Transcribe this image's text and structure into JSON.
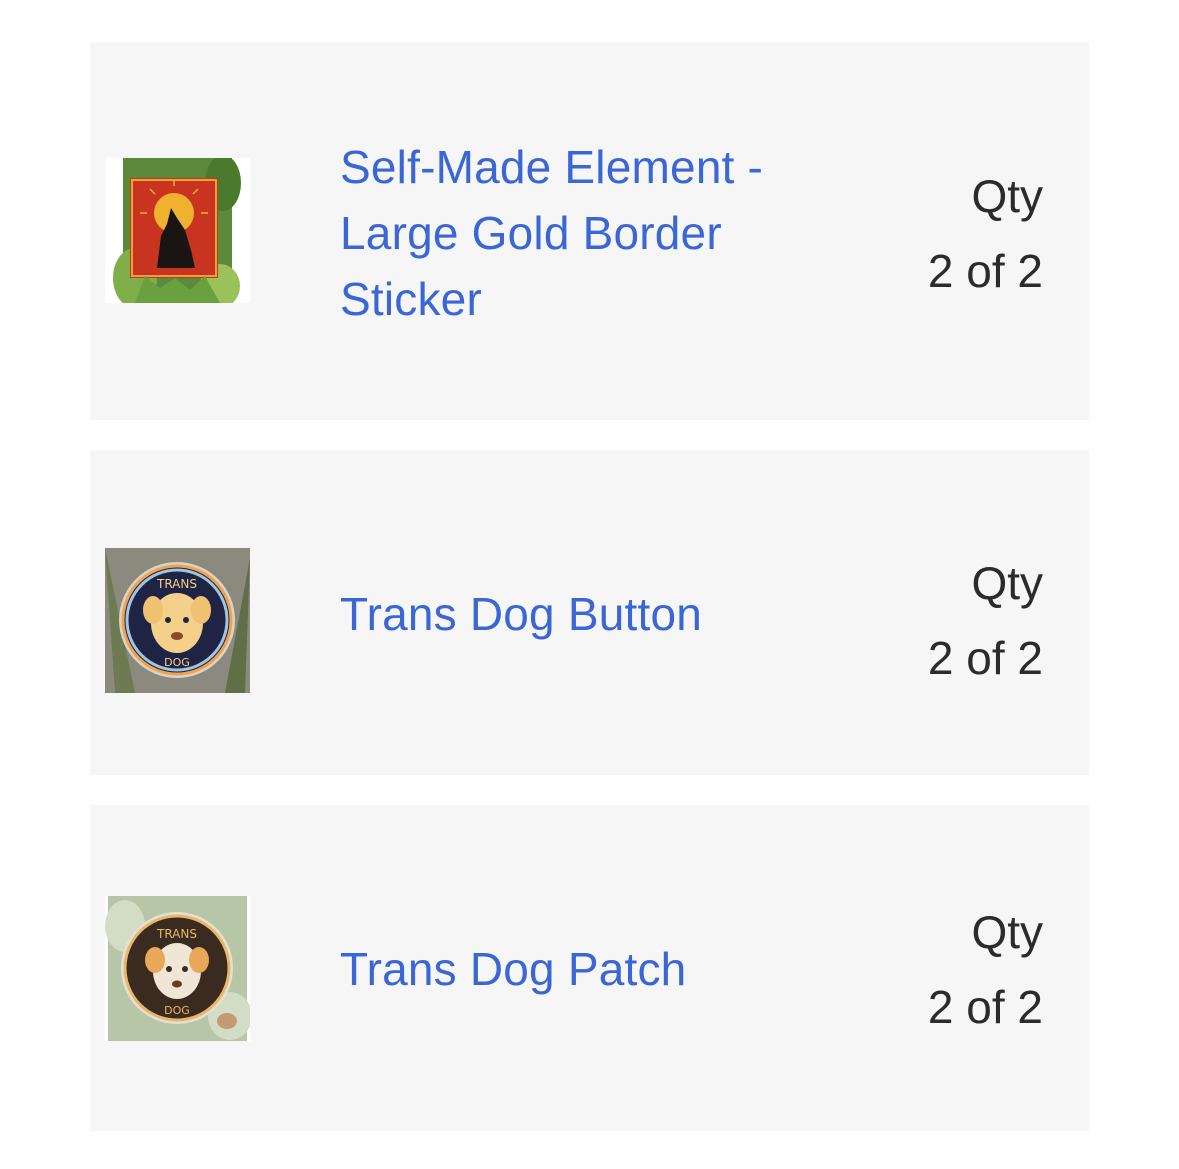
{
  "order_items": [
    {
      "title": "Self-Made Element - Large Gold Border Sticker",
      "qty_label": "Qty",
      "qty_value": "2 of 2",
      "thumbnail_icon": "wolf-sticker-image"
    },
    {
      "title": "Trans Dog Button",
      "qty_label": "Qty",
      "qty_value": "2 of 2",
      "thumbnail_icon": "dog-button-image"
    },
    {
      "title": "Trans Dog Patch",
      "qty_label": "Qty",
      "qty_value": "2 of 2",
      "thumbnail_icon": "dog-patch-image"
    }
  ],
  "colors": {
    "card_background": "#f6f6f6",
    "link_blue": "#3a66d6",
    "qty_text": "#2b2b2b"
  }
}
